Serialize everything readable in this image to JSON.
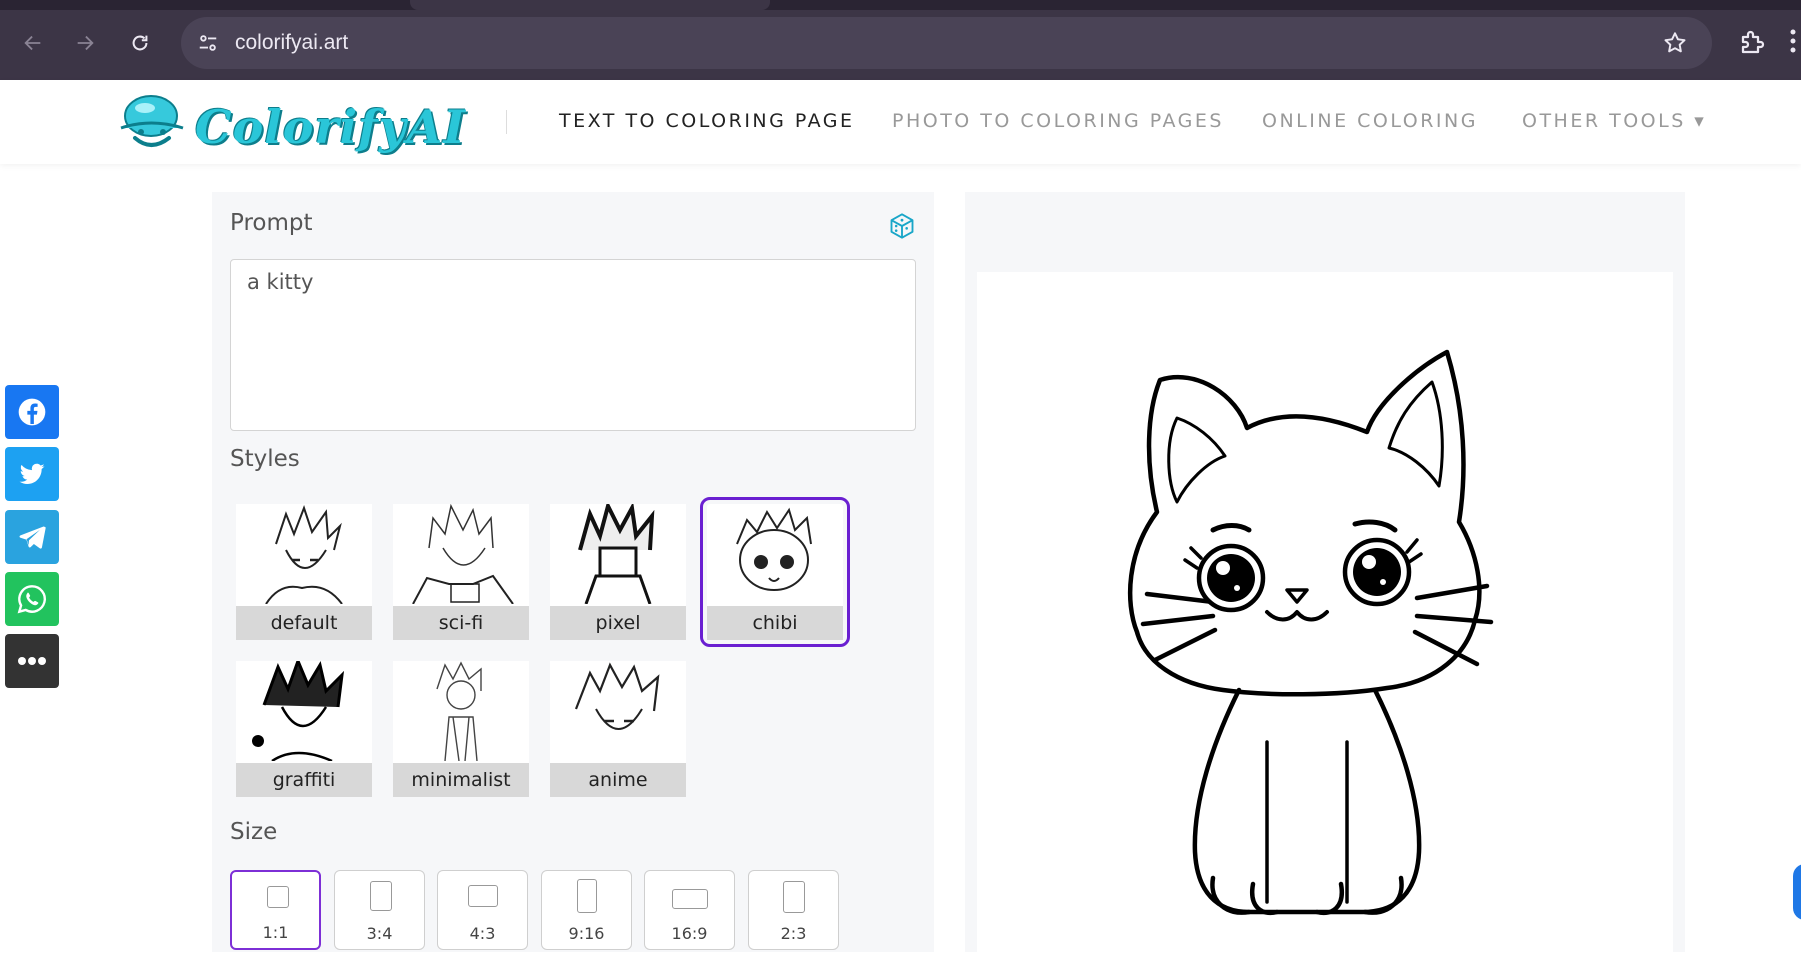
{
  "browser": {
    "url": "colorifyai.art",
    "icons": {
      "back": "arrow-left-icon",
      "forward": "arrow-right-icon",
      "reload": "reload-icon",
      "site_info": "tune-icon",
      "bookmark": "star-icon",
      "extensions": "puzzle-icon",
      "menu": "more-vert-icon"
    }
  },
  "header": {
    "logo_text": "ColorifyAI",
    "nav": [
      {
        "label": "TEXT TO COLORING PAGE",
        "active": true
      },
      {
        "label": "PHOTO TO COLORING PAGES",
        "active": false
      },
      {
        "label": "ONLINE COLORING",
        "active": false
      },
      {
        "label": "OTHER TOOLS ▾",
        "active": false
      }
    ]
  },
  "social": [
    {
      "name": "facebook-icon",
      "color": "#1877f2"
    },
    {
      "name": "twitter-icon",
      "color": "#1da1f2"
    },
    {
      "name": "telegram-icon",
      "color": "#2aa3df"
    },
    {
      "name": "whatsapp-icon",
      "color": "#22c35e"
    },
    {
      "name": "more-icon",
      "color": "#333333"
    }
  ],
  "form": {
    "prompt_label": "Prompt",
    "prompt_value": "a kitty",
    "styles_label": "Styles",
    "styles": [
      {
        "label": "default",
        "selected": false
      },
      {
        "label": "sci-fi",
        "selected": false
      },
      {
        "label": "pixel",
        "selected": false
      },
      {
        "label": "chibi",
        "selected": true
      },
      {
        "label": "graffiti",
        "selected": false
      },
      {
        "label": "minimalist",
        "selected": false
      },
      {
        "label": "anime",
        "selected": false
      }
    ],
    "size_label": "Size",
    "sizes": [
      {
        "label": "1:1",
        "selected": true
      },
      {
        "label": "3:4",
        "selected": false
      },
      {
        "label": "4:3",
        "selected": false
      },
      {
        "label": "9:16",
        "selected": false
      },
      {
        "label": "16:9",
        "selected": false
      },
      {
        "label": "2:3",
        "selected": false
      }
    ]
  },
  "colors": {
    "accent": "#6a1fd1",
    "brand": "#2ac6d8"
  }
}
